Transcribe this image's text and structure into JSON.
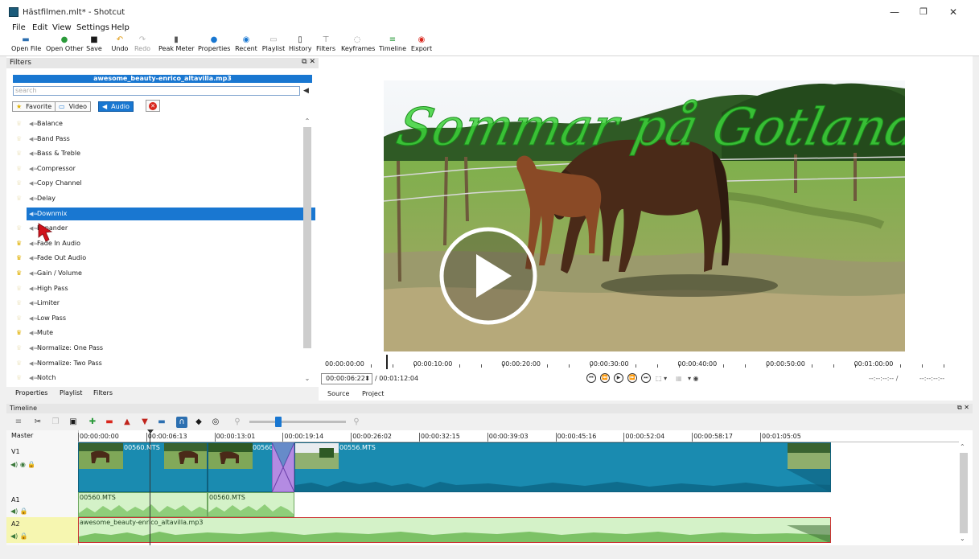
{
  "window": {
    "title": "Hästfilmen.mlt* - Shotcut",
    "minimize": "—",
    "maximize": "❐",
    "close": "✕"
  },
  "menu": [
    "File",
    "Edit",
    "View",
    "Settings",
    "Help"
  ],
  "toolbar": [
    {
      "label": "Open File",
      "icon": "folder-icon"
    },
    {
      "label": "Open Other",
      "icon": "open-other-icon"
    },
    {
      "label": "Save",
      "icon": "save-icon"
    },
    {
      "label": "Undo",
      "icon": "undo-icon"
    },
    {
      "label": "Redo",
      "icon": "redo-icon"
    },
    {
      "label": "Peak Meter",
      "icon": "peak-meter-icon"
    },
    {
      "label": "Properties",
      "icon": "info-icon"
    },
    {
      "label": "Recent",
      "icon": "recent-icon"
    },
    {
      "label": "Playlist",
      "icon": "playlist-icon"
    },
    {
      "label": "History",
      "icon": "history-icon"
    },
    {
      "label": "Filters",
      "icon": "filters-icon"
    },
    {
      "label": "Keyframes",
      "icon": "keyframes-icon"
    },
    {
      "label": "Timeline",
      "icon": "timeline-icon"
    },
    {
      "label": "Export",
      "icon": "export-icon"
    }
  ],
  "filters": {
    "panel_title": "Filters",
    "panel_controls": "⧉ ✕",
    "clip_name": "awesome_beauty-enrico_altavilla.mp3",
    "search_placeholder": "search",
    "search_clear": "◀",
    "buttons": {
      "favorite": "Favorite",
      "video": "Video",
      "audio": "Audio"
    },
    "selected_category": "Audio",
    "items": [
      {
        "name": "Balance",
        "fav": false
      },
      {
        "name": "Band Pass",
        "fav": false
      },
      {
        "name": "Bass & Treble",
        "fav": false
      },
      {
        "name": "Compressor",
        "fav": false
      },
      {
        "name": "Copy Channel",
        "fav": false
      },
      {
        "name": "Delay",
        "fav": false
      },
      {
        "name": "Downmix",
        "fav": false,
        "selected": true
      },
      {
        "name": "Expander",
        "fav": false
      },
      {
        "name": "Fade In Audio",
        "fav": true
      },
      {
        "name": "Fade Out Audio",
        "fav": true
      },
      {
        "name": "Gain / Volume",
        "fav": true
      },
      {
        "name": "High Pass",
        "fav": false
      },
      {
        "name": "Limiter",
        "fav": false
      },
      {
        "name": "Low Pass",
        "fav": false
      },
      {
        "name": "Mute",
        "fav": true
      },
      {
        "name": "Normalize: One Pass",
        "fav": false
      },
      {
        "name": "Normalize: Two Pass",
        "fav": false
      },
      {
        "name": "Notch",
        "fav": false
      }
    ],
    "bottom_tabs": [
      "Properties",
      "Playlist",
      "Filters"
    ]
  },
  "player": {
    "overlay_title": "Sommar på Gotland",
    "ruler": [
      "00:00:00:00",
      "00:00:10:00",
      "00:00:20:00",
      "00:00:30:00",
      "00:00:40:00",
      "00:00:50:00",
      "00:01:00:00"
    ],
    "current_tc": "00:00:06:22",
    "total_tc": "/ 00:01:12:04",
    "in_point": "--:--:--:-- /",
    "out_point": "--:--:--:--",
    "tabs": [
      "Source",
      "Project"
    ]
  },
  "timeline": {
    "panel_title": "Timeline",
    "panel_controls": "⧉ ✕",
    "ruler": [
      "00:00:00:00",
      "00:00:06:13",
      "00:00:13:01",
      "00:00:19:14",
      "00:00:26:02",
      "00:00:32:15",
      "00:00:39:03",
      "00:00:45:16",
      "00:00:52:04",
      "00:00:58:17",
      "00:01:05:05"
    ],
    "tracks": {
      "master": "Master",
      "v1": "V1",
      "a1": "A1",
      "a2": "A2"
    },
    "clips": {
      "v1_1": "00560.MTS",
      "v1_2": "00560.",
      "v1_3": "00556.MTS",
      "a1_1": "00560.MTS",
      "a1_2": "00560.MTS",
      "a2_1": "awesome_beauty-enrico_altavilla.mp3"
    },
    "colors": {
      "video_clip": "#1a8bb0",
      "audio_clip": "#d4f2c8",
      "selected_track": "#f6f6b0",
      "accent": "#1977d1"
    }
  }
}
